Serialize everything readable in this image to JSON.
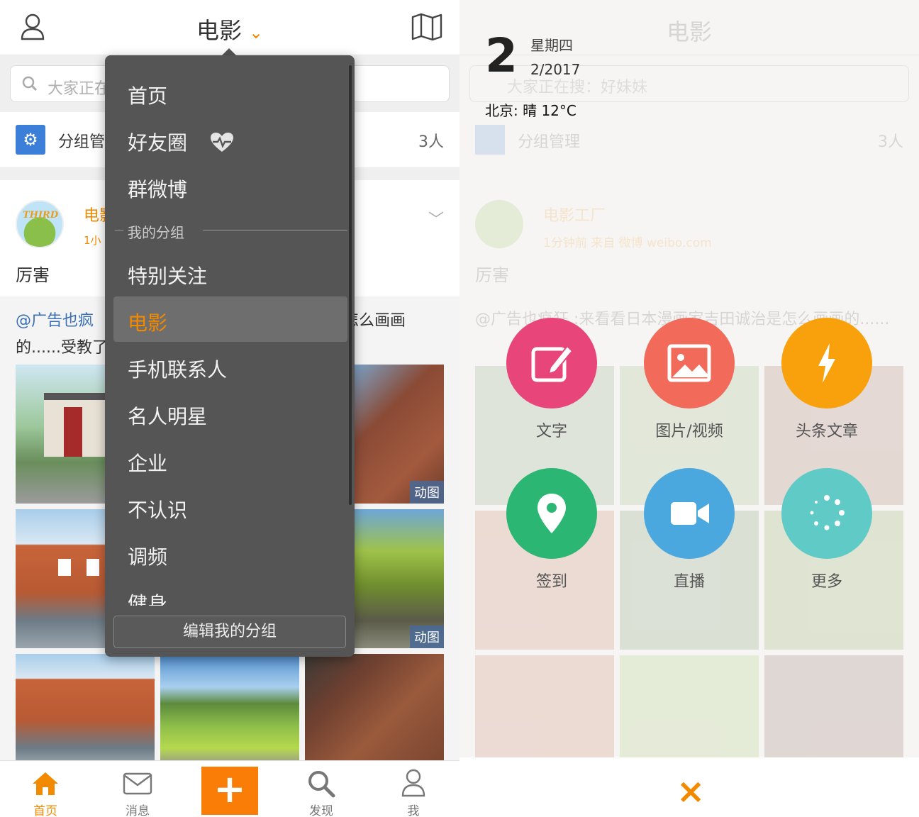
{
  "left": {
    "header": {
      "title": "电影",
      "chevron": "⌄",
      "user_icon": "user-icon",
      "map_icon": "map-icon"
    },
    "search": {
      "placeholder": "大家正在"
    },
    "group": {
      "label": "分组管",
      "count": "3人"
    },
    "post": {
      "user": "电影",
      "time": "1小",
      "avatar_text": "THIRD",
      "text": "厉害",
      "repost_at": "@广告也疯",
      "repost_tail": "是怎么画画",
      "repost_line2": "的......受教了",
      "badges": [
        "动图",
        "动图"
      ]
    },
    "dropdown": {
      "items": [
        {
          "label": "首页"
        },
        {
          "label": "好友圈"
        },
        {
          "label": "群微博"
        },
        {
          "label": "特别关注"
        },
        {
          "label": "电影"
        },
        {
          "label": "手机联系人"
        },
        {
          "label": "名人明星"
        },
        {
          "label": "企业"
        },
        {
          "label": "不认识"
        },
        {
          "label": "调频"
        },
        {
          "label": "健身"
        }
      ],
      "section": "我的分组",
      "edit": "编辑我的分组"
    },
    "tabbar": {
      "items": [
        {
          "label": "首页",
          "icon": "home-icon"
        },
        {
          "label": "消息",
          "icon": "mail-icon"
        },
        {
          "label": "发现",
          "icon": "search-icon"
        },
        {
          "label": "我",
          "icon": "user-icon"
        }
      ],
      "plus": "+"
    }
  },
  "right": {
    "weather": {
      "day_num": "2",
      "weekday": "星期四",
      "date": "2/2017",
      "city": "北京: 晴 12°C"
    },
    "bg": {
      "title": "电影",
      "search": "大家正在搜：好妹妹",
      "group": "分组管理",
      "count": "3人",
      "user": "电影工厂",
      "meta": "1分钟前  来自 微博 weibo.com",
      "text": "厉害",
      "repost": "@广告也疯狂 :来看看日本漫画家吉田诚治是怎么画画的......"
    },
    "actions": [
      {
        "label": "文字",
        "icon": "edit-icon",
        "color": "#e8457a"
      },
      {
        "label": "图片/视频",
        "icon": "image-icon",
        "color": "#f26a5a"
      },
      {
        "label": "头条文章",
        "icon": "lightning-icon",
        "color": "#f9a10c"
      },
      {
        "label": "签到",
        "icon": "location-icon",
        "color": "#2bb673"
      },
      {
        "label": "直播",
        "icon": "video-icon",
        "color": "#4aa8de"
      },
      {
        "label": "更多",
        "icon": "more-icon",
        "color": "#5fcac6"
      }
    ],
    "close": "×"
  },
  "colors": {
    "accent": "#f28a00",
    "menu_bg": "#555555",
    "plus_bg": "#fa7d08"
  }
}
